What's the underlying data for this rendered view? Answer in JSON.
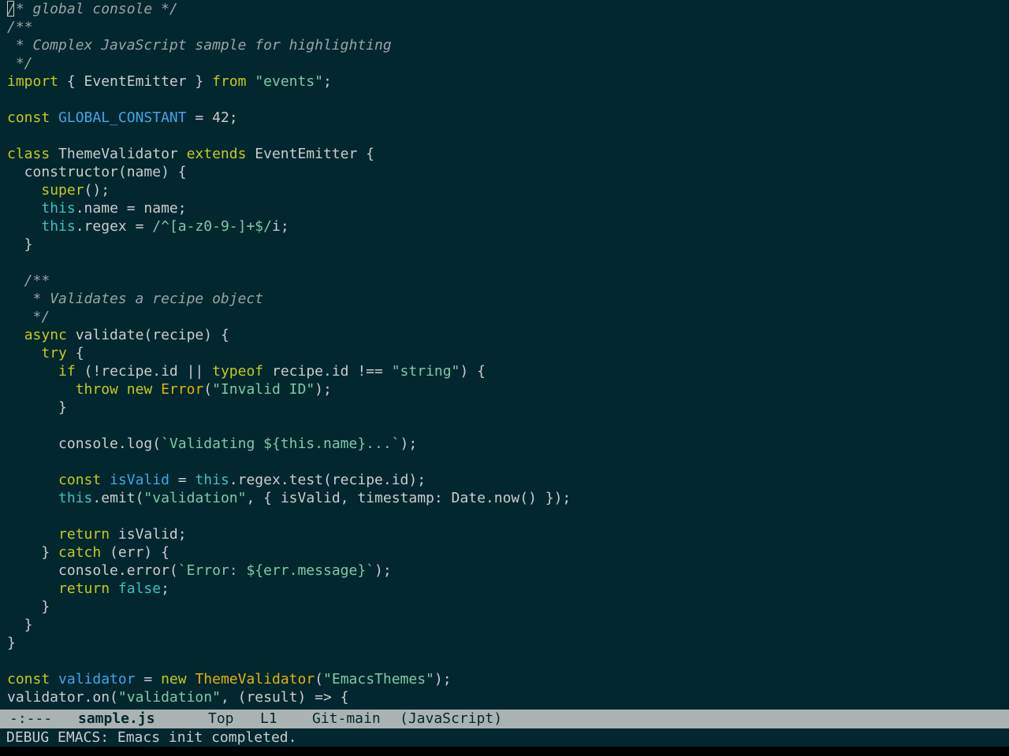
{
  "editor": {
    "file_name": "sample.js",
    "language": "JavaScript",
    "theme_colors": {
      "background": "#03272f",
      "foreground": "#cbcccb",
      "comment": "#9aa3a3",
      "keyword": "#c5c91f",
      "string": "#7fc8a6",
      "variable": "#3fa7e8",
      "type": "#e2b20a",
      "builtin": "#3fc0c0",
      "modeline_bg": "#a9b4b2",
      "modeline_fg": "#04262e"
    },
    "lines": [
      [
        {
          "t": "/* global console */",
          "k": "comment"
        }
      ],
      [
        {
          "t": "/**",
          "k": "comment"
        }
      ],
      [
        {
          "t": " * Complex JavaScript sample for highlighting",
          "k": "comment"
        }
      ],
      [
        {
          "t": " */",
          "k": "comment"
        }
      ],
      [
        {
          "t": "import",
          "k": "keyword"
        },
        {
          "t": " { EventEmitter } ",
          "k": "plain"
        },
        {
          "t": "from",
          "k": "keyword"
        },
        {
          "t": " ",
          "k": "plain"
        },
        {
          "t": "\"events\"",
          "k": "string"
        },
        {
          "t": ";",
          "k": "plain"
        }
      ],
      [],
      [
        {
          "t": "const",
          "k": "keyword"
        },
        {
          "t": " ",
          "k": "plain"
        },
        {
          "t": "GLOBAL_CONSTANT",
          "k": "var"
        },
        {
          "t": " = 42;",
          "k": "plain"
        }
      ],
      [],
      [
        {
          "t": "class",
          "k": "keyword"
        },
        {
          "t": " ThemeValidator ",
          "k": "plain"
        },
        {
          "t": "extends",
          "k": "keyword"
        },
        {
          "t": " EventEmitter {",
          "k": "plain"
        }
      ],
      [
        {
          "t": "  constructor(name) {",
          "k": "plain"
        }
      ],
      [
        {
          "t": "    ",
          "k": "plain"
        },
        {
          "t": "super",
          "k": "keyword"
        },
        {
          "t": "();",
          "k": "plain"
        }
      ],
      [
        {
          "t": "    ",
          "k": "plain"
        },
        {
          "t": "this",
          "k": "builtin"
        },
        {
          "t": ".name = name;",
          "k": "plain"
        }
      ],
      [
        {
          "t": "    ",
          "k": "plain"
        },
        {
          "t": "this",
          "k": "builtin"
        },
        {
          "t": ".regex = ",
          "k": "plain"
        },
        {
          "t": "/^[a-z0-9-]+$/",
          "k": "string"
        },
        {
          "t": "i;",
          "k": "plain"
        }
      ],
      [
        {
          "t": "  }",
          "k": "plain"
        }
      ],
      [],
      [
        {
          "t": "  /**",
          "k": "comment"
        }
      ],
      [
        {
          "t": "   * Validates a recipe object",
          "k": "comment"
        }
      ],
      [
        {
          "t": "   */",
          "k": "comment"
        }
      ],
      [
        {
          "t": "  ",
          "k": "plain"
        },
        {
          "t": "async",
          "k": "keyword"
        },
        {
          "t": " validate(recipe) {",
          "k": "plain"
        }
      ],
      [
        {
          "t": "    ",
          "k": "plain"
        },
        {
          "t": "try",
          "k": "keyword"
        },
        {
          "t": " {",
          "k": "plain"
        }
      ],
      [
        {
          "t": "      ",
          "k": "plain"
        },
        {
          "t": "if",
          "k": "keyword"
        },
        {
          "t": " (!recipe.id || ",
          "k": "plain"
        },
        {
          "t": "typeof",
          "k": "keyword"
        },
        {
          "t": " recipe.id !== ",
          "k": "plain"
        },
        {
          "t": "\"string\"",
          "k": "string"
        },
        {
          "t": ") {",
          "k": "plain"
        }
      ],
      [
        {
          "t": "        ",
          "k": "plain"
        },
        {
          "t": "throw",
          "k": "keyword"
        },
        {
          "t": " ",
          "k": "plain"
        },
        {
          "t": "new",
          "k": "keyword"
        },
        {
          "t": " ",
          "k": "plain"
        },
        {
          "t": "Error",
          "k": "type"
        },
        {
          "t": "(",
          "k": "plain"
        },
        {
          "t": "\"Invalid ID\"",
          "k": "string"
        },
        {
          "t": ");",
          "k": "plain"
        }
      ],
      [
        {
          "t": "      }",
          "k": "plain"
        }
      ],
      [],
      [
        {
          "t": "      console.log(",
          "k": "plain"
        },
        {
          "t": "`Validating ${this.name}...`",
          "k": "string"
        },
        {
          "t": ");",
          "k": "plain"
        }
      ],
      [],
      [
        {
          "t": "      ",
          "k": "plain"
        },
        {
          "t": "const",
          "k": "keyword"
        },
        {
          "t": " ",
          "k": "plain"
        },
        {
          "t": "isValid",
          "k": "var"
        },
        {
          "t": " = ",
          "k": "plain"
        },
        {
          "t": "this",
          "k": "builtin"
        },
        {
          "t": ".regex.test(recipe.id);",
          "k": "plain"
        }
      ],
      [
        {
          "t": "      ",
          "k": "plain"
        },
        {
          "t": "this",
          "k": "builtin"
        },
        {
          "t": ".emit(",
          "k": "plain"
        },
        {
          "t": "\"validation\"",
          "k": "string"
        },
        {
          "t": ", { isValid, timestamp: Date.now() });",
          "k": "plain"
        }
      ],
      [],
      [
        {
          "t": "      ",
          "k": "plain"
        },
        {
          "t": "return",
          "k": "keyword"
        },
        {
          "t": " isValid;",
          "k": "plain"
        }
      ],
      [
        {
          "t": "    } ",
          "k": "plain"
        },
        {
          "t": "catch",
          "k": "keyword"
        },
        {
          "t": " (err) {",
          "k": "plain"
        }
      ],
      [
        {
          "t": "      console.error(",
          "k": "plain"
        },
        {
          "t": "`Error: ${err.message}`",
          "k": "string"
        },
        {
          "t": ");",
          "k": "plain"
        }
      ],
      [
        {
          "t": "      ",
          "k": "plain"
        },
        {
          "t": "return",
          "k": "keyword"
        },
        {
          "t": " ",
          "k": "plain"
        },
        {
          "t": "false",
          "k": "builtin"
        },
        {
          "t": ";",
          "k": "plain"
        }
      ],
      [
        {
          "t": "    }",
          "k": "plain"
        }
      ],
      [
        {
          "t": "  }",
          "k": "plain"
        }
      ],
      [
        {
          "t": "}",
          "k": "plain"
        }
      ],
      [],
      [
        {
          "t": "const",
          "k": "keyword"
        },
        {
          "t": " ",
          "k": "plain"
        },
        {
          "t": "validator",
          "k": "var"
        },
        {
          "t": " = ",
          "k": "plain"
        },
        {
          "t": "new",
          "k": "keyword"
        },
        {
          "t": " ",
          "k": "plain"
        },
        {
          "t": "ThemeValidator",
          "k": "type"
        },
        {
          "t": "(",
          "k": "plain"
        },
        {
          "t": "\"EmacsThemes\"",
          "k": "string"
        },
        {
          "t": ");",
          "k": "plain"
        }
      ],
      [
        {
          "t": "validator.on(",
          "k": "plain"
        },
        {
          "t": "\"validation\"",
          "k": "string"
        },
        {
          "t": ", (result) => {",
          "k": "plain"
        }
      ]
    ]
  },
  "modeline": {
    "status": "-:---",
    "buffer_name": "sample.js",
    "position": "Top",
    "line": "L1",
    "vc_branch": "Git-main",
    "major_mode": "(JavaScript)"
  },
  "minibuffer": {
    "message": "DEBUG EMACS: Emacs init completed."
  }
}
